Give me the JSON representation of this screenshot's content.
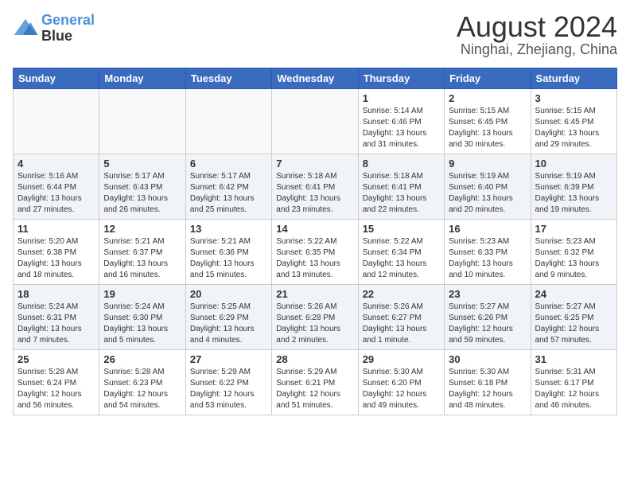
{
  "header": {
    "logo_line1": "General",
    "logo_line2": "Blue",
    "title": "August 2024",
    "subtitle": "Ninghai, Zhejiang, China"
  },
  "days_of_week": [
    "Sunday",
    "Monday",
    "Tuesday",
    "Wednesday",
    "Thursday",
    "Friday",
    "Saturday"
  ],
  "weeks": [
    [
      {
        "num": "",
        "info": ""
      },
      {
        "num": "",
        "info": ""
      },
      {
        "num": "",
        "info": ""
      },
      {
        "num": "",
        "info": ""
      },
      {
        "num": "1",
        "info": "Sunrise: 5:14 AM\nSunset: 6:46 PM\nDaylight: 13 hours\nand 31 minutes."
      },
      {
        "num": "2",
        "info": "Sunrise: 5:15 AM\nSunset: 6:45 PM\nDaylight: 13 hours\nand 30 minutes."
      },
      {
        "num": "3",
        "info": "Sunrise: 5:15 AM\nSunset: 6:45 PM\nDaylight: 13 hours\nand 29 minutes."
      }
    ],
    [
      {
        "num": "4",
        "info": "Sunrise: 5:16 AM\nSunset: 6:44 PM\nDaylight: 13 hours\nand 27 minutes."
      },
      {
        "num": "5",
        "info": "Sunrise: 5:17 AM\nSunset: 6:43 PM\nDaylight: 13 hours\nand 26 minutes."
      },
      {
        "num": "6",
        "info": "Sunrise: 5:17 AM\nSunset: 6:42 PM\nDaylight: 13 hours\nand 25 minutes."
      },
      {
        "num": "7",
        "info": "Sunrise: 5:18 AM\nSunset: 6:41 PM\nDaylight: 13 hours\nand 23 minutes."
      },
      {
        "num": "8",
        "info": "Sunrise: 5:18 AM\nSunset: 6:41 PM\nDaylight: 13 hours\nand 22 minutes."
      },
      {
        "num": "9",
        "info": "Sunrise: 5:19 AM\nSunset: 6:40 PM\nDaylight: 13 hours\nand 20 minutes."
      },
      {
        "num": "10",
        "info": "Sunrise: 5:19 AM\nSunset: 6:39 PM\nDaylight: 13 hours\nand 19 minutes."
      }
    ],
    [
      {
        "num": "11",
        "info": "Sunrise: 5:20 AM\nSunset: 6:38 PM\nDaylight: 13 hours\nand 18 minutes."
      },
      {
        "num": "12",
        "info": "Sunrise: 5:21 AM\nSunset: 6:37 PM\nDaylight: 13 hours\nand 16 minutes."
      },
      {
        "num": "13",
        "info": "Sunrise: 5:21 AM\nSunset: 6:36 PM\nDaylight: 13 hours\nand 15 minutes."
      },
      {
        "num": "14",
        "info": "Sunrise: 5:22 AM\nSunset: 6:35 PM\nDaylight: 13 hours\nand 13 minutes."
      },
      {
        "num": "15",
        "info": "Sunrise: 5:22 AM\nSunset: 6:34 PM\nDaylight: 13 hours\nand 12 minutes."
      },
      {
        "num": "16",
        "info": "Sunrise: 5:23 AM\nSunset: 6:33 PM\nDaylight: 13 hours\nand 10 minutes."
      },
      {
        "num": "17",
        "info": "Sunrise: 5:23 AM\nSunset: 6:32 PM\nDaylight: 13 hours\nand 9 minutes."
      }
    ],
    [
      {
        "num": "18",
        "info": "Sunrise: 5:24 AM\nSunset: 6:31 PM\nDaylight: 13 hours\nand 7 minutes."
      },
      {
        "num": "19",
        "info": "Sunrise: 5:24 AM\nSunset: 6:30 PM\nDaylight: 13 hours\nand 5 minutes."
      },
      {
        "num": "20",
        "info": "Sunrise: 5:25 AM\nSunset: 6:29 PM\nDaylight: 13 hours\nand 4 minutes."
      },
      {
        "num": "21",
        "info": "Sunrise: 5:26 AM\nSunset: 6:28 PM\nDaylight: 13 hours\nand 2 minutes."
      },
      {
        "num": "22",
        "info": "Sunrise: 5:26 AM\nSunset: 6:27 PM\nDaylight: 13 hours\nand 1 minute."
      },
      {
        "num": "23",
        "info": "Sunrise: 5:27 AM\nSunset: 6:26 PM\nDaylight: 12 hours\nand 59 minutes."
      },
      {
        "num": "24",
        "info": "Sunrise: 5:27 AM\nSunset: 6:25 PM\nDaylight: 12 hours\nand 57 minutes."
      }
    ],
    [
      {
        "num": "25",
        "info": "Sunrise: 5:28 AM\nSunset: 6:24 PM\nDaylight: 12 hours\nand 56 minutes."
      },
      {
        "num": "26",
        "info": "Sunrise: 5:28 AM\nSunset: 6:23 PM\nDaylight: 12 hours\nand 54 minutes."
      },
      {
        "num": "27",
        "info": "Sunrise: 5:29 AM\nSunset: 6:22 PM\nDaylight: 12 hours\nand 53 minutes."
      },
      {
        "num": "28",
        "info": "Sunrise: 5:29 AM\nSunset: 6:21 PM\nDaylight: 12 hours\nand 51 minutes."
      },
      {
        "num": "29",
        "info": "Sunrise: 5:30 AM\nSunset: 6:20 PM\nDaylight: 12 hours\nand 49 minutes."
      },
      {
        "num": "30",
        "info": "Sunrise: 5:30 AM\nSunset: 6:18 PM\nDaylight: 12 hours\nand 48 minutes."
      },
      {
        "num": "31",
        "info": "Sunrise: 5:31 AM\nSunset: 6:17 PM\nDaylight: 12 hours\nand 46 minutes."
      }
    ]
  ]
}
